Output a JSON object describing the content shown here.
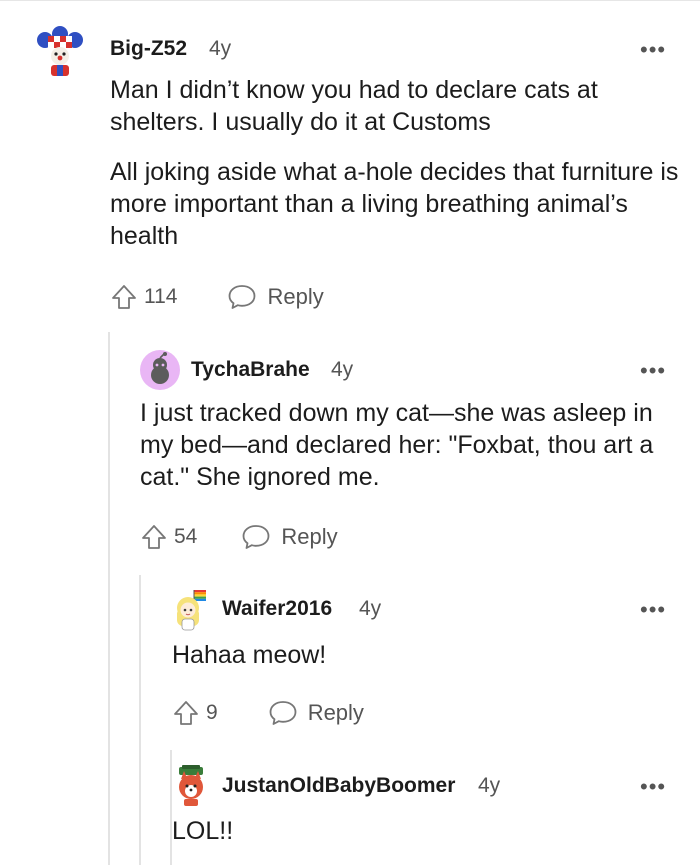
{
  "comments": [
    {
      "username": "Big-Z52",
      "age": "4y",
      "paragraphs": [
        "Man I didn’t know you had to declare cats at shelters. I usually do it at Customs",
        "All joking aside what a-hole decides that furniture is more important than a living breathing animal’s health"
      ],
      "votes": "114",
      "reply_label": "Reply",
      "more_label": "•••"
    },
    {
      "username": "TychaBrahe",
      "age": "4y",
      "paragraphs": [
        "I just tracked down my cat—she was asleep in my bed—and declared her: \"Foxbat, thou art a cat.\" She ignored me."
      ],
      "votes": "54",
      "reply_label": "Reply",
      "more_label": "•••"
    },
    {
      "username": "Waifer2016",
      "age": "4y",
      "paragraphs": [
        "Hahaa meow!"
      ],
      "votes": "9",
      "reply_label": "Reply",
      "more_label": "•••"
    },
    {
      "username": "JustanOldBabyBoomer",
      "age": "4y",
      "paragraphs": [
        "LOL!!"
      ],
      "more_label": "•••"
    }
  ],
  "icons": {
    "upvote": "arrow-up-outline-icon",
    "reply": "speech-bubble-icon",
    "more": "horizontal-ellipsis-icon"
  },
  "colors": {
    "text": "#1c1c1c",
    "meta": "#555555",
    "thread_line": "#e3e3e3",
    "snoo_avatar_bg": "#e9b6f5"
  }
}
